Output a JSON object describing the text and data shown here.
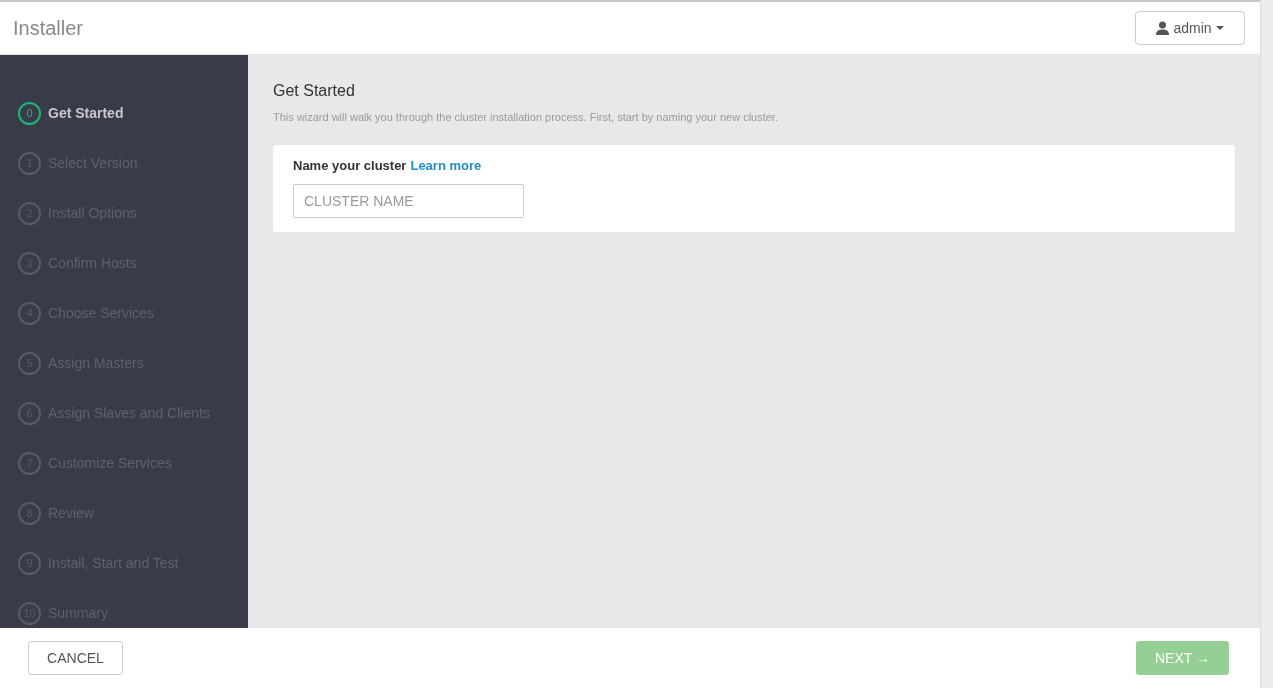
{
  "header": {
    "title": "Installer",
    "user_menu": "admin"
  },
  "steps": [
    {
      "number": "0",
      "label": "Get Started",
      "selected": true
    },
    {
      "number": "1",
      "label": "Select Version",
      "selected": false
    },
    {
      "number": "2",
      "label": "Install Options",
      "selected": false
    },
    {
      "number": "3",
      "label": "Confirm Hosts",
      "selected": false
    },
    {
      "number": "4",
      "label": "Choose Services",
      "selected": false
    },
    {
      "number": "5",
      "label": "Assign Masters",
      "selected": false
    },
    {
      "number": "6",
      "label": "Assign Slaves and Clients",
      "selected": false
    },
    {
      "number": "7",
      "label": "Customize Services",
      "selected": false
    },
    {
      "number": "8",
      "label": "Review",
      "selected": false
    },
    {
      "number": "9",
      "label": "Install, Start and Test",
      "selected": false
    },
    {
      "number": "10",
      "label": "Summary",
      "selected": false
    }
  ],
  "content": {
    "title": "Get Started",
    "description": "This wizard will walk you through the cluster installation process. First, start by naming your new cluster.",
    "field_label": "Name your cluster",
    "link": "Learn more",
    "cluster_name": {
      "placeholder": "CLUSTER NAME"
    }
  },
  "footer": {
    "cancel": "CANCEL",
    "next": {
      "label": "NEXT →",
      "disabled": true
    }
  }
}
